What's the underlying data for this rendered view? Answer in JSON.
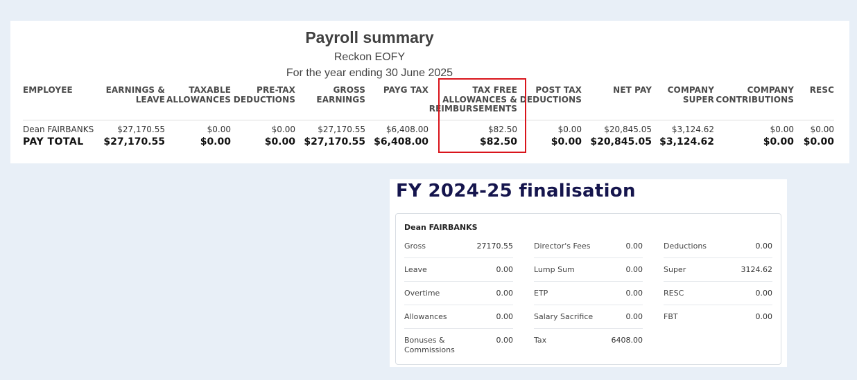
{
  "payroll": {
    "title": "Payroll summary",
    "company": "Reckon EOFY",
    "period": "For the year ending 30 June 2025",
    "columns": [
      "EMPLOYEE",
      "EARNINGS &\nLEAVE",
      "TAXABLE\nALLOWANCES",
      "PRE-TAX\nDEDUCTIONS",
      "GROSS\nEARNINGS",
      "PAYG TAX",
      "TAX FREE\nALLOWANCES &\nREIMBURSEMENTS",
      "POST TAX\nDEDUCTIONS",
      "NET PAY",
      "COMPANY\nSUPER",
      "COMPANY\nCONTRIBUTIONS",
      "RESC"
    ],
    "rows": [
      [
        "Dean FAIRBANKS",
        "$27,170.55",
        "$0.00",
        "$0.00",
        "$27,170.55",
        "$6,408.00",
        "$82.50",
        "$0.00",
        "$20,845.05",
        "$3,124.62",
        "$0.00",
        "$0.00"
      ]
    ],
    "total": [
      "PAY TOTAL",
      "$27,170.55",
      "$0.00",
      "$0.00",
      "$27,170.55",
      "$6,408.00",
      "$82.50",
      "$0.00",
      "$20,845.05",
      "$3,124.62",
      "$0.00",
      "$0.00"
    ],
    "highlight_color": "#d9141b"
  },
  "finalisation": {
    "title": "FY 2024-25 finalisation",
    "employee": "Dean FAIRBANKS",
    "columns": [
      [
        {
          "label": "Gross",
          "value": "27170.55"
        },
        {
          "label": "Leave",
          "value": "0.00"
        },
        {
          "label": "Overtime",
          "value": "0.00"
        },
        {
          "label": "Allowances",
          "value": "0.00"
        },
        {
          "label": "Bonuses & Commissions",
          "value": "0.00"
        }
      ],
      [
        {
          "label": "Director's Fees",
          "value": "0.00"
        },
        {
          "label": "Lump Sum",
          "value": "0.00"
        },
        {
          "label": "ETP",
          "value": "0.00"
        },
        {
          "label": "Salary Sacrifice",
          "value": "0.00"
        },
        {
          "label": "Tax",
          "value": "6408.00"
        }
      ],
      [
        {
          "label": "Deductions",
          "value": "0.00"
        },
        {
          "label": "Super",
          "value": "3124.62"
        },
        {
          "label": "RESC",
          "value": "0.00"
        },
        {
          "label": "FBT",
          "value": "0.00"
        }
      ]
    ],
    "title_color": "#15154d"
  }
}
